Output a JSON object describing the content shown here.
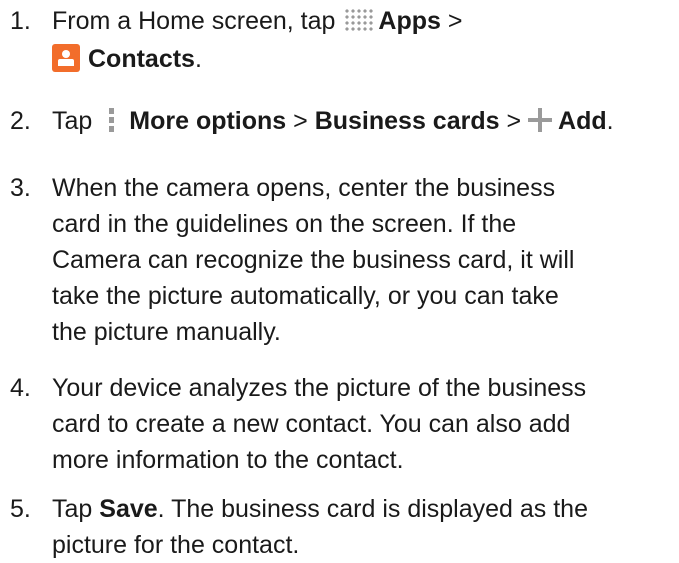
{
  "steps": [
    {
      "number": "1.",
      "line1_prefix": "From a Home screen, tap ",
      "apps_icon": "apps-grid-icon",
      "apps_label": "Apps",
      "sep1": " >",
      "contacts_icon": "contacts-icon",
      "contacts_label": "Contacts",
      "end": "."
    },
    {
      "number": "2.",
      "prefix": "Tap ",
      "more_icon": "more-options-icon",
      "more_label": "More options",
      "sep1": " > ",
      "business_label": "Business cards",
      "sep2": " > ",
      "add_icon": "add-icon",
      "add_label": "Add",
      "end": "."
    },
    {
      "number": "3.",
      "lines": [
        "When the camera opens, center the business",
        "card in the guidelines on the screen. If the",
        "Camera can recognize the business card, it will",
        "take the picture automatically, or you can take",
        "the picture manually."
      ]
    },
    {
      "number": "4.",
      "lines": [
        "Your device analyzes the picture of the business",
        "card to create a new contact. You can also add",
        "more information to the contact."
      ]
    },
    {
      "number": "5.",
      "prefix": "Tap ",
      "save_label": "Save",
      "rest_line1": ". The business card is displayed as the",
      "line2": "picture for the contact."
    }
  ]
}
